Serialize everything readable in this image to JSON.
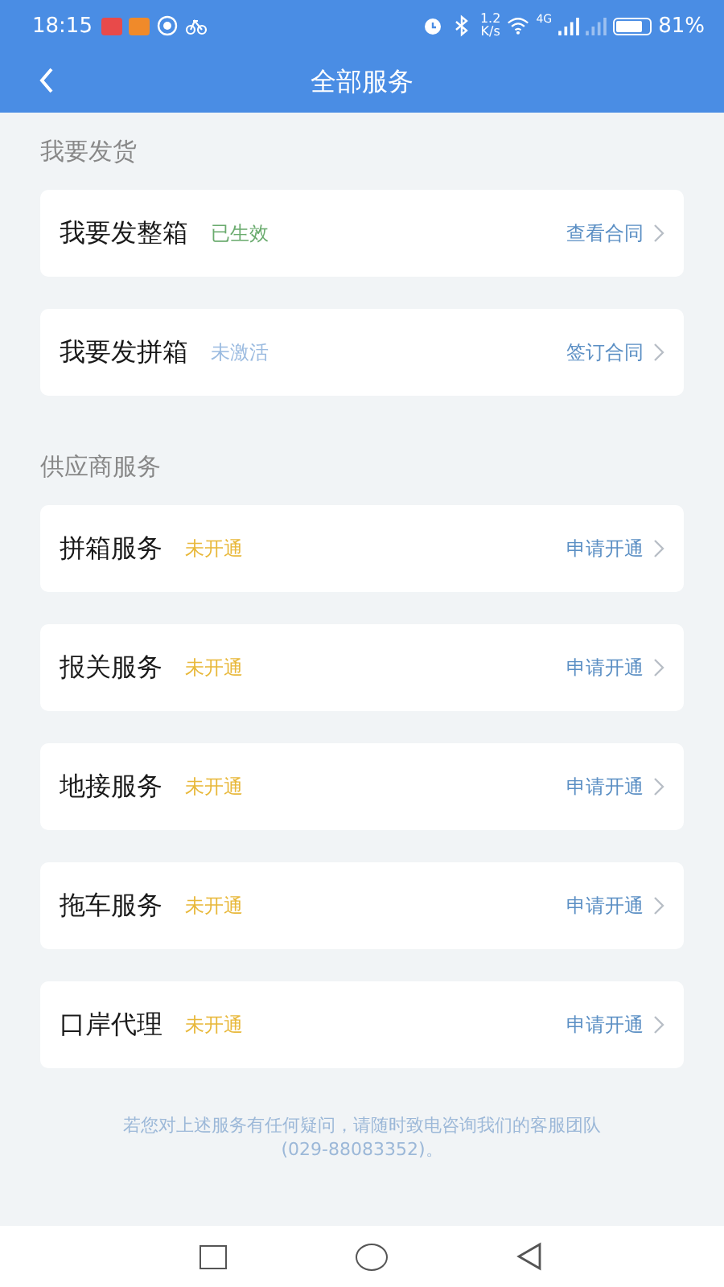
{
  "status_bar": {
    "time": "18:15",
    "net_speed": "1.2\nK/s",
    "network": "4G",
    "battery": "81%"
  },
  "header": {
    "title": "全部服务"
  },
  "sections": [
    {
      "title": "我要发货",
      "items": [
        {
          "name": "我要发整箱",
          "status": "已生效",
          "color": "#6aab6e",
          "action": "查看合同"
        },
        {
          "name": "我要发拼箱",
          "status": "未激活",
          "color": "#9bbbe0",
          "action": "签订合同"
        }
      ]
    },
    {
      "title": "供应商服务",
      "items": [
        {
          "name": "拼箱服务",
          "status": "未开通",
          "color": "#e8b83a",
          "action": "申请开通"
        },
        {
          "name": "报关服务",
          "status": "未开通",
          "color": "#e8b83a",
          "action": "申请开通"
        },
        {
          "name": "地接服务",
          "status": "未开通",
          "color": "#e8b83a",
          "action": "申请开通"
        },
        {
          "name": "拖车服务",
          "status": "未开通",
          "color": "#e8b83a",
          "action": "申请开通"
        },
        {
          "name": "口岸代理",
          "status": "未开通",
          "color": "#e8b83a",
          "action": "申请开通"
        }
      ]
    }
  ],
  "footer": "若您对上述服务有任何疑问，请随时致电咨询我们的客服团队\n(029-88083352)。"
}
